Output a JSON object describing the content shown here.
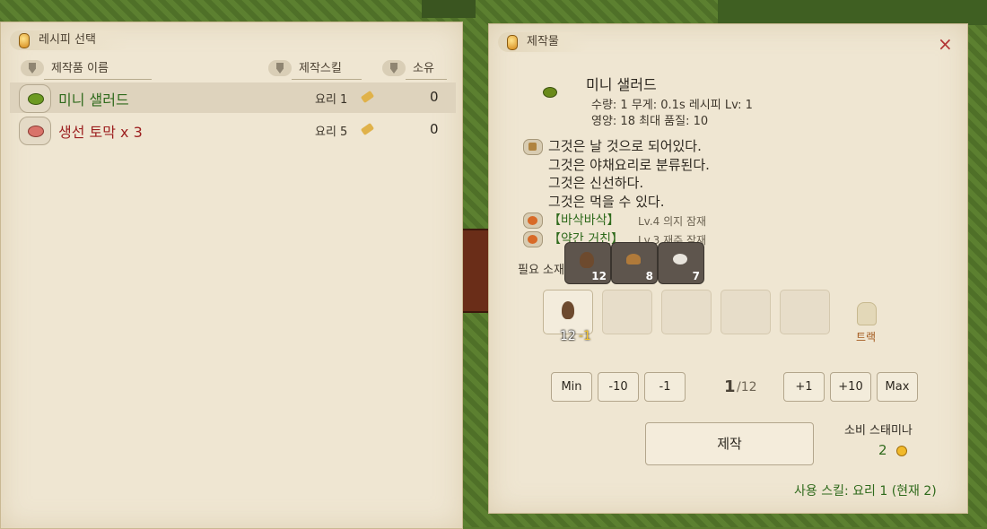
{
  "left_panel": {
    "title": "레시피 선택",
    "columns": {
      "name": "제작품 이름",
      "skill": "제작스킬",
      "own": "소유"
    },
    "recipes": [
      {
        "name": "미니 샐러드",
        "skill": "요리 1",
        "own": "0",
        "name_color": "#2f6a1c",
        "icon": "salad-icon"
      },
      {
        "name": "생선 토막 x 3",
        "skill": "요리 5",
        "own": "0",
        "name_color": "#9c1f1f",
        "icon": "fish-chunk-icon"
      }
    ]
  },
  "right_panel": {
    "title": "제작물",
    "close": "×",
    "item": {
      "name": "미니 샐러드",
      "stats1": "수량: 1 무게: 0.1s  레시피 Lv: 1",
      "stats2": "영양: 18  최대 품질: 10"
    },
    "description": [
      "그것은 날 것으로 되어있다.",
      "그것은 야채요리로 분류된다.",
      "그것은 신선하다.",
      "그것은 먹을 수 있다."
    ],
    "traits": [
      {
        "name": "【바삭바삭】",
        "desc": "Lv.4 의지 잠재"
      },
      {
        "name": "【약간 거친】",
        "desc": "Lv.3 재주 잠재"
      }
    ],
    "materials": {
      "label": "필요 소재",
      "items": [
        {
          "icon": "pinecone-icon",
          "count": "12"
        },
        {
          "icon": "mushroom-icon",
          "count": "8"
        },
        {
          "icon": "egg-icon",
          "count": "7"
        }
      ]
    },
    "input": {
      "count": "12",
      "minus": "-1",
      "truck_label": "트랙"
    },
    "quantity": {
      "min": "Min",
      "minus10": "-10",
      "minus1": "-1",
      "current": "1",
      "max_text": "/12",
      "plus1": "+1",
      "plus10": "+10",
      "max": "Max"
    },
    "craft_button": "제작",
    "stamina": {
      "label": "소비 스태미나",
      "value": "2"
    },
    "use_skill": "사용 스킬: 요리 1 (현재 2)"
  }
}
